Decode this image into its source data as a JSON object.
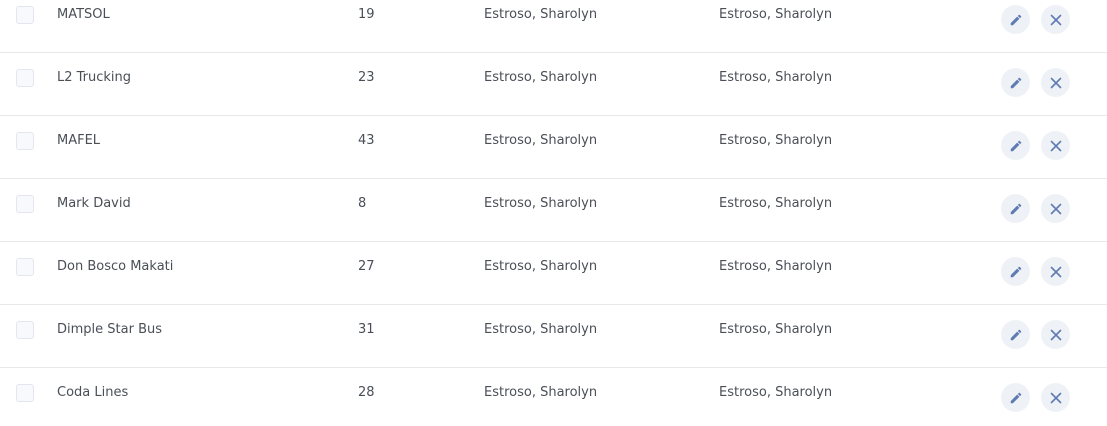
{
  "colors": {
    "icon": "#5f7bb3",
    "row_divider": "#e6e8ec",
    "action_bg": "#eef1f6",
    "text": "#4a4f57"
  },
  "icons": {
    "edit": "pencil-icon",
    "delete": "close-icon"
  },
  "rows": [
    {
      "name": "MATSOL",
      "count": "19",
      "created_by": "Estroso, Sharolyn",
      "updated_by": "Estroso, Sharolyn"
    },
    {
      "name": "L2 Trucking",
      "count": "23",
      "created_by": "Estroso, Sharolyn",
      "updated_by": "Estroso, Sharolyn"
    },
    {
      "name": "MAFEL",
      "count": "43",
      "created_by": "Estroso, Sharolyn",
      "updated_by": "Estroso, Sharolyn"
    },
    {
      "name": "Mark David",
      "count": "8",
      "created_by": "Estroso, Sharolyn",
      "updated_by": "Estroso, Sharolyn"
    },
    {
      "name": "Don Bosco Makati",
      "count": "27",
      "created_by": "Estroso, Sharolyn",
      "updated_by": "Estroso, Sharolyn"
    },
    {
      "name": "Dimple Star Bus",
      "count": "31",
      "created_by": "Estroso, Sharolyn",
      "updated_by": "Estroso, Sharolyn"
    },
    {
      "name": "Coda Lines",
      "count": "28",
      "created_by": "Estroso, Sharolyn",
      "updated_by": "Estroso, Sharolyn"
    }
  ]
}
